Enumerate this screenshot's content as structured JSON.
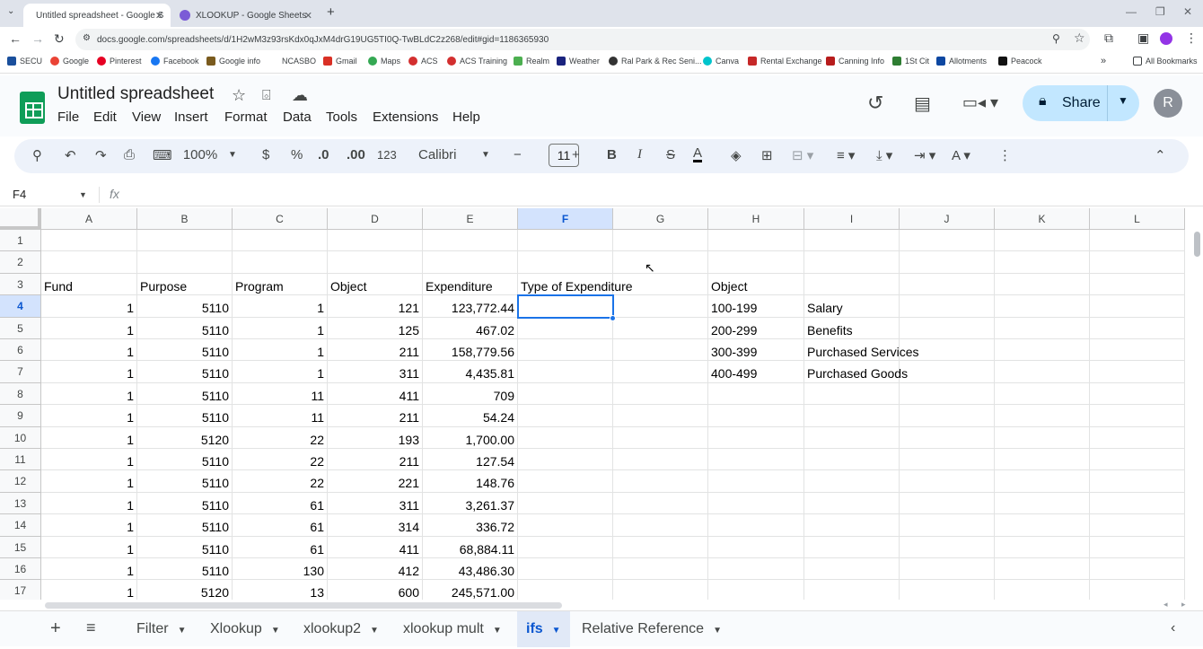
{
  "browser": {
    "tabs": [
      {
        "title": "Untitled spreadsheet - Google S",
        "active": true
      },
      {
        "title": "XLOOKUP - Google Sheets",
        "active": false
      }
    ],
    "url": "docs.google.com/spreadsheets/d/1H2wM3z93rsKdx0qJxM4drG19UG5TI0Q-TwBLdC2z268/edit#gid=1186365930",
    "bookmarks": [
      "SECU",
      "Google",
      "Pinterest",
      "Facebook",
      "Google info",
      "NCASBO",
      "Gmail",
      "Maps",
      "ACS",
      "ACS Training",
      "Realm",
      "Weather",
      "Ral Park & Rec Seni...",
      "Canva",
      "Rental Exchange",
      "Canning Info",
      "1St Cit",
      "Allotments",
      "Peacock"
    ],
    "all_bookmarks": "All Bookmarks"
  },
  "app": {
    "title": "Untitled spreadsheet",
    "menus": [
      "File",
      "Edit",
      "View",
      "Insert",
      "Format",
      "Data",
      "Tools",
      "Extensions",
      "Help"
    ],
    "share_label": "Share",
    "avatar_initial": "R"
  },
  "toolbar": {
    "zoom": "100%",
    "currency": "$",
    "percent": "%",
    "dec_decrease": ".0",
    "dec_increase": ".00",
    "format_more": "123",
    "font": "Calibri",
    "font_size": "11",
    "bold": "B",
    "italic": "I"
  },
  "formula_bar": {
    "name_box": "F4",
    "fx": "fx",
    "value": ""
  },
  "grid": {
    "columns": [
      "A",
      "B",
      "C",
      "D",
      "E",
      "F",
      "G",
      "H",
      "I",
      "J",
      "K",
      "L"
    ],
    "selected_column": "F",
    "rows": [
      {
        "n": "1",
        "cells": [
          "",
          "",
          "",
          "",
          "",
          "",
          "",
          "",
          ""
        ]
      },
      {
        "n": "2",
        "cells": [
          "",
          "",
          "",
          "",
          "",
          "",
          "",
          "",
          ""
        ]
      },
      {
        "n": "3",
        "cells": [
          "Fund",
          "Purpose",
          "Program",
          "Object",
          "Expenditure",
          "Type of Expenditure",
          "",
          "Object",
          ""
        ]
      },
      {
        "n": "4",
        "cells": [
          "1",
          "5110",
          "1",
          "121",
          "123,772.44",
          "",
          "",
          "100-199",
          "Salary"
        ]
      },
      {
        "n": "5",
        "cells": [
          "1",
          "5110",
          "1",
          "125",
          "467.02",
          "",
          "",
          "200-299",
          "Benefits"
        ]
      },
      {
        "n": "6",
        "cells": [
          "1",
          "5110",
          "1",
          "211",
          "158,779.56",
          "",
          "",
          "300-399",
          "Purchased Services"
        ]
      },
      {
        "n": "7",
        "cells": [
          "1",
          "5110",
          "1",
          "311",
          "4,435.81",
          "",
          "",
          "400-499",
          "Purchased Goods"
        ]
      },
      {
        "n": "8",
        "cells": [
          "1",
          "5110",
          "11",
          "411",
          "709",
          "",
          "",
          "",
          ""
        ]
      },
      {
        "n": "9",
        "cells": [
          "1",
          "5110",
          "11",
          "211",
          "54.24",
          "",
          "",
          "",
          ""
        ]
      },
      {
        "n": "10",
        "cells": [
          "1",
          "5120",
          "22",
          "193",
          "1,700.00",
          "",
          "",
          "",
          ""
        ]
      },
      {
        "n": "11",
        "cells": [
          "1",
          "5110",
          "22",
          "211",
          "127.54",
          "",
          "",
          "",
          ""
        ]
      },
      {
        "n": "12",
        "cells": [
          "1",
          "5110",
          "22",
          "221",
          "148.76",
          "",
          "",
          "",
          ""
        ]
      },
      {
        "n": "13",
        "cells": [
          "1",
          "5110",
          "61",
          "311",
          "3,261.37",
          "",
          "",
          "",
          ""
        ]
      },
      {
        "n": "14",
        "cells": [
          "1",
          "5110",
          "61",
          "314",
          "336.72",
          "",
          "",
          "",
          ""
        ]
      },
      {
        "n": "15",
        "cells": [
          "1",
          "5110",
          "61",
          "411",
          "68,884.11",
          "",
          "",
          "",
          ""
        ]
      },
      {
        "n": "16",
        "cells": [
          "1",
          "5110",
          "130",
          "412",
          "43,486.30",
          "",
          "",
          "",
          ""
        ]
      },
      {
        "n": "17",
        "cells": [
          "1",
          "5120",
          "13",
          "600",
          "245,571.00",
          "",
          "",
          "",
          ""
        ]
      }
    ],
    "selected_cell": "F4"
  },
  "sheet_tabs": [
    {
      "label": "Filter",
      "active": false
    },
    {
      "label": "Xlookup",
      "active": false
    },
    {
      "label": "xlookup2",
      "active": false
    },
    {
      "label": "xlookup mult",
      "active": false
    },
    {
      "label": "ifs",
      "active": true
    },
    {
      "label": "Relative Reference",
      "active": false
    }
  ]
}
